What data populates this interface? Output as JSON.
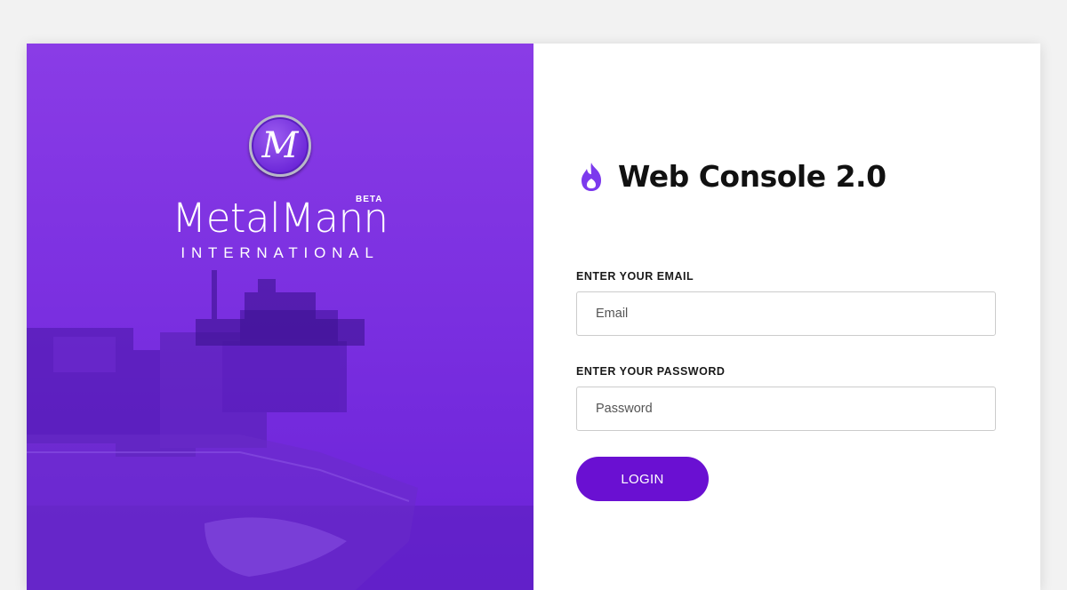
{
  "brand": {
    "logo_letter": "M",
    "name": "MetalMann",
    "badge": "BETA",
    "subtitle": "INTERNATIONAL"
  },
  "app": {
    "title": "Web Console 2.0",
    "icon": "flame-icon"
  },
  "form": {
    "email_label": "ENTER YOUR EMAIL",
    "email_placeholder": "Email",
    "email_value": "",
    "password_label": "ENTER YOUR PASSWORD",
    "password_placeholder": "Password",
    "password_value": "",
    "login_label": "LOGIN"
  },
  "colors": {
    "hero_purple": "#7a2fe0",
    "button_purple": "#6a10d2",
    "icon_purple": "#7c3aed"
  }
}
